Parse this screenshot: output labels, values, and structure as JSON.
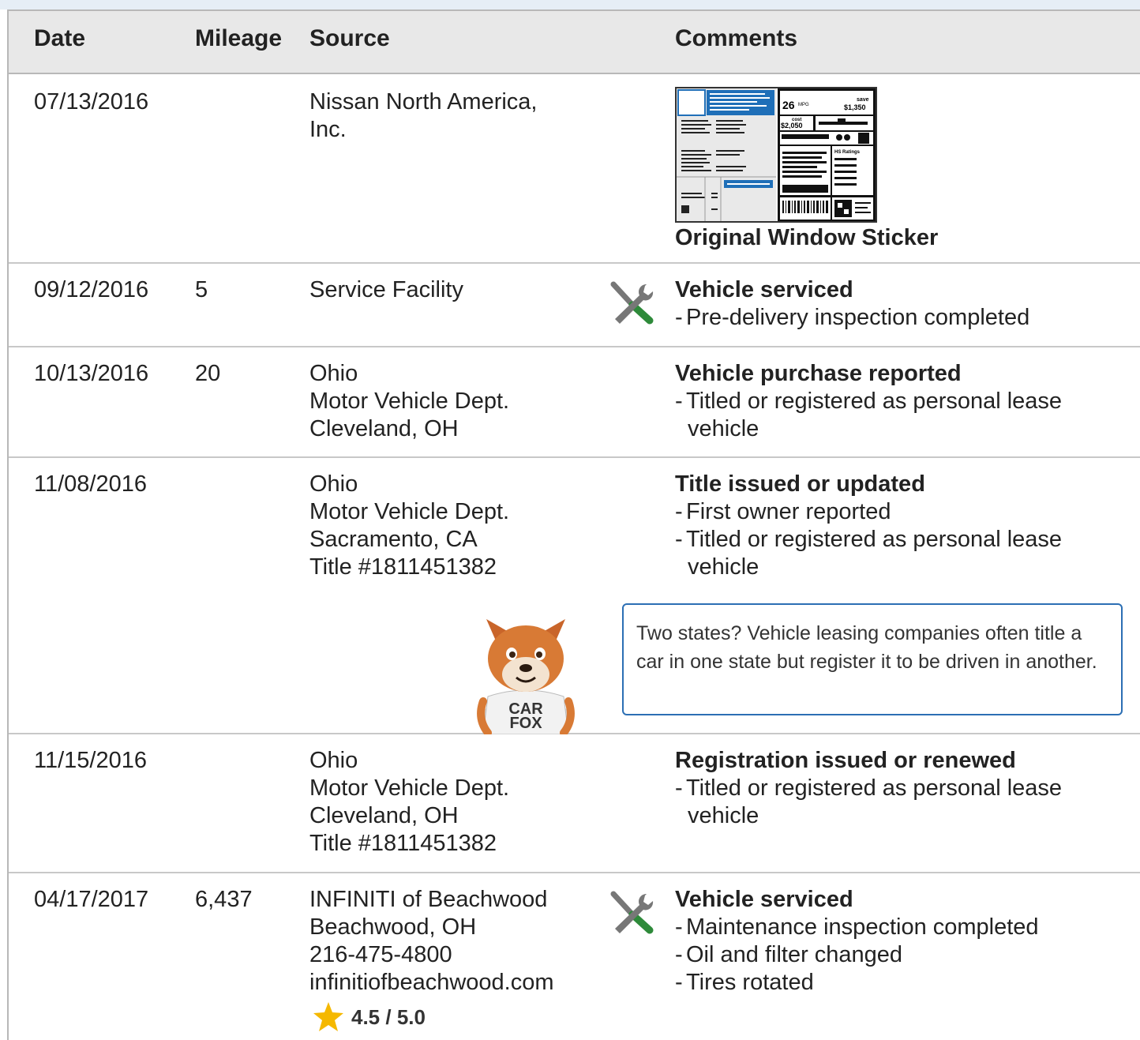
{
  "header": {
    "date": "Date",
    "mileage": "Mileage",
    "source": "Source",
    "comments": "Comments"
  },
  "colors": {
    "header_bg": "#e8e8e8",
    "tip_border": "#2c6fb4",
    "wrench_green": "#2e8a3a",
    "star": "#f5b800"
  },
  "records": [
    {
      "date": "07/13/2016",
      "mileage": "",
      "source": [
        "Nissan North America,",
        "Inc."
      ],
      "sticker": {
        "label": "Original Window Sticker",
        "mpg": "26",
        "mpg_unit": "MPG",
        "save_label": "save",
        "save_value": "$1,350",
        "cost_label": "cost",
        "cost_value": "$2,050",
        "rating_label": "HS Ratings"
      }
    },
    {
      "date": "09/12/2016",
      "mileage": "5",
      "source": [
        "Service Facility"
      ],
      "icon": "wrench-screwdriver-icon",
      "title": "Vehicle serviced",
      "bullets": [
        "Pre-delivery inspection completed"
      ]
    },
    {
      "date": "10/13/2016",
      "mileage": "20",
      "source": [
        "Ohio",
        "Motor Vehicle Dept.",
        "Cleveland, OH"
      ],
      "title": "Vehicle purchase reported",
      "bullets": [
        "Titled or registered as personal lease vehicle"
      ]
    },
    {
      "date": "11/08/2016",
      "mileage": "",
      "source": [
        "Ohio",
        "Motor Vehicle Dept.",
        "Sacramento, CA",
        "Title #1811451382"
      ],
      "title": "Title issued or updated",
      "bullets": [
        "First owner reported",
        "Titled or registered as personal lease vehicle"
      ],
      "tip": "Two states? Vehicle leasing companies often title a car in one state but register it to be driven in another.",
      "mascot_shirt": [
        "CAR",
        "FOX"
      ]
    },
    {
      "date": "11/15/2016",
      "mileage": "",
      "source": [
        "Ohio",
        "Motor Vehicle Dept.",
        "Cleveland, OH",
        "Title #1811451382"
      ],
      "title": "Registration issued or renewed",
      "bullets": [
        "Titled or registered as personal lease vehicle"
      ]
    },
    {
      "date": "04/17/2017",
      "mileage": "6,437",
      "source": [
        "INFINITI of Beachwood",
        "Beachwood, OH",
        "216-475-4800",
        "infinitiofbeachwood.com"
      ],
      "rating": "4.5 / 5.0",
      "icon": "wrench-screwdriver-icon",
      "title": "Vehicle serviced",
      "bullets": [
        "Maintenance inspection completed",
        "Oil and filter changed",
        "Tires rotated"
      ]
    }
  ]
}
